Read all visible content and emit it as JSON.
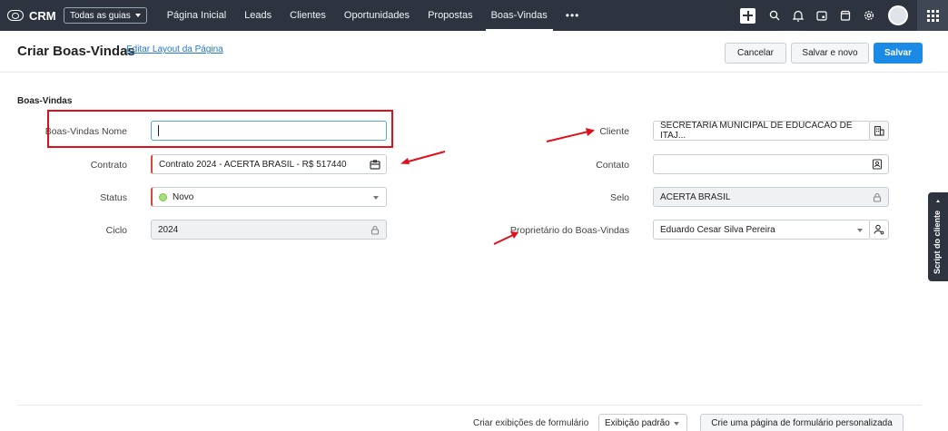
{
  "nav": {
    "brand": "CRM",
    "guides_label": "Todas as guias",
    "items": [
      "Página Inicial",
      "Leads",
      "Clientes",
      "Oportunidades",
      "Propostas",
      "Boas-Vindas"
    ],
    "active_item": "Boas-Vindas",
    "more": "•••"
  },
  "header": {
    "title": "Criar Boas-Vindas",
    "edit_layout": "Editar Layout da Página",
    "cancel": "Cancelar",
    "save_and_new": "Salvar e novo",
    "save": "Salvar"
  },
  "section_title": "Boas-Vindas",
  "fields": {
    "nome": {
      "label": "Boas-Vindas Nome",
      "value": ""
    },
    "contrato": {
      "label": "Contrato",
      "value": "Contrato 2024 - ACERTA BRASIL - R$ 517440"
    },
    "status": {
      "label": "Status",
      "value": "Novo"
    },
    "ciclo": {
      "label": "Ciclo",
      "value": "2024"
    },
    "cliente": {
      "label": "Cliente",
      "value": "SECRETARIA MUNICIPAL DE EDUCACAO DE ITAJ..."
    },
    "contato": {
      "label": "Contato",
      "value": ""
    },
    "selo": {
      "label": "Selo",
      "value": "ACERTA BRASIL"
    },
    "proprietario": {
      "label": "Proprietário do Boas-Vindas",
      "value": "Eduardo Cesar Silva Pereira"
    }
  },
  "script_tab": "Script do cliente",
  "footer": {
    "label": "Criar exibições de formulário",
    "select_value": "Exibição padrão",
    "custom_button": "Crie uma página de formulário personalizada"
  },
  "colors": {
    "topbar": "#2d3440",
    "primary": "#1a8ae6",
    "annotation": "#e0101a"
  }
}
